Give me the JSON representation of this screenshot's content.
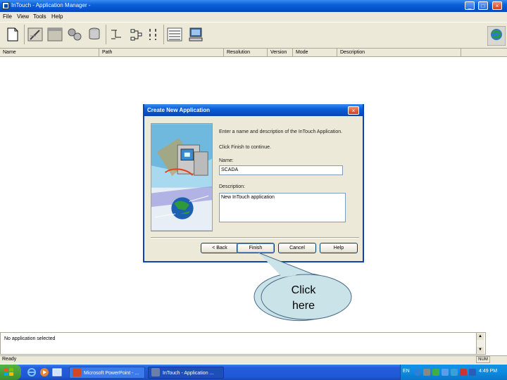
{
  "window": {
    "title": "InTouch - Application Manager -",
    "controls": {
      "minimize": "_",
      "maximize": "□",
      "close": "×"
    }
  },
  "menu": {
    "items": [
      "File",
      "View",
      "Tools",
      "Help"
    ]
  },
  "toolbar": {
    "buttons": [
      "new-application-icon",
      "edit-icon",
      "windowmaker-icon",
      "windowviewer-icon",
      "dbload-icon",
      "dbdump-icon",
      "columns-icon",
      "list-view-icon",
      "details-view-icon",
      "computer-icon",
      "wizard-icon"
    ]
  },
  "columns": [
    "Name",
    "Path",
    "Resolution",
    "Version",
    "Mode",
    "Description"
  ],
  "dialog": {
    "title": "Create New Application",
    "close": "×",
    "instruction": "Enter a name and description of the InTouch Application.",
    "finish_hint": "Click Finish to continue.",
    "name_label": "Name:",
    "name_value": "SCADA",
    "description_label": "Description:",
    "description_value": "New InTouch application",
    "buttons": {
      "back": "< Back",
      "finish": "Finish",
      "cancel": "Cancel",
      "help": "Help"
    }
  },
  "callout": {
    "line1": "Click",
    "line2": "here",
    "fill": "#c9e3e8"
  },
  "bottom_pane": {
    "text": "No application selected"
  },
  "statusbar": {
    "left": "Ready",
    "num": "NUM"
  },
  "taskbar": {
    "tasks": [
      "Microsoft PowerPoint - ...",
      "InTouch - Application ..."
    ],
    "lang": "EN",
    "clock": "4:49 PM"
  },
  "colors": {
    "titlebar": "#0a5fd8",
    "face": "#ece9d8",
    "taskbar": "#245edb",
    "start": "#3c8f2f"
  }
}
